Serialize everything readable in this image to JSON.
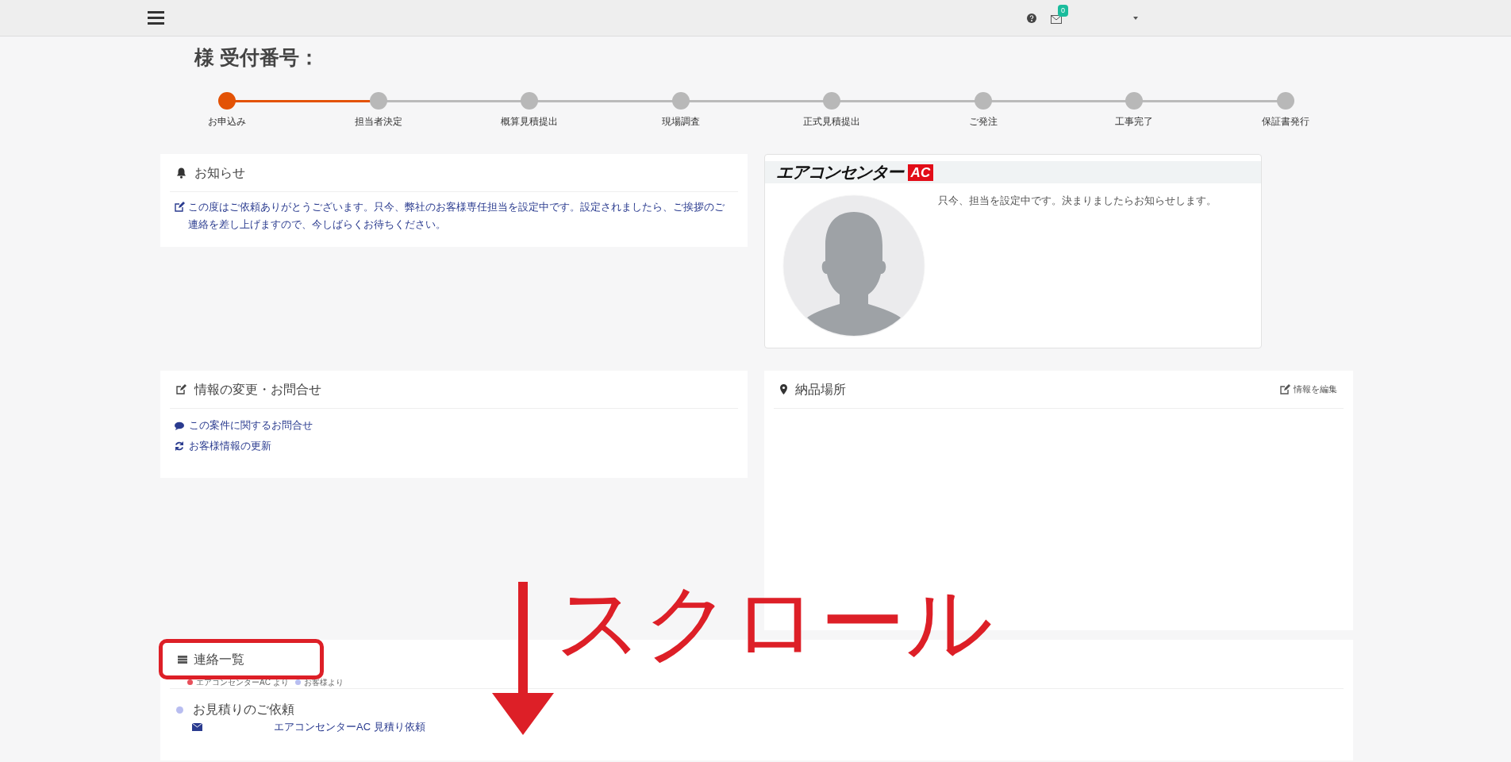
{
  "header": {
    "notification_count": "0"
  },
  "page_title": "様 受付番号：",
  "steps": [
    {
      "label": "お申込み",
      "active": true
    },
    {
      "label": "担当者決定",
      "active": false
    },
    {
      "label": "概算見積提出",
      "active": false
    },
    {
      "label": "現場調査",
      "active": false
    },
    {
      "label": "正式見積提出",
      "active": false
    },
    {
      "label": "ご発注",
      "active": false
    },
    {
      "label": "工事完了",
      "active": false
    },
    {
      "label": "保証書発行",
      "active": false
    }
  ],
  "notice": {
    "title": "お知らせ",
    "message": "この度はご依頼ありがとうございます。只今、弊社のお客様専任担当を設定中です。設定されましたら、ご挨拶のご連絡を差し上げますので、今しばらくお待ちください。"
  },
  "staff_card": {
    "logo_text": "エアコンセンター",
    "logo_badge": "AC",
    "message": "只今、担当を設定中です。決まりましたらお知らせします。"
  },
  "inquiry": {
    "title": "情報の変更・お問合せ",
    "links": [
      {
        "kind": "chat",
        "label": "この案件に関するお問合せ"
      },
      {
        "kind": "refresh",
        "label": "お客様情報の更新"
      }
    ]
  },
  "delivery": {
    "title": "納品場所",
    "edit_link": "情報を編集"
  },
  "messages": {
    "title": "連絡一覧",
    "legend": [
      {
        "label": "エアコンセンターAC より",
        "color": "#e8505b"
      },
      {
        "label": "お客様より",
        "color": "#b8bdf0"
      }
    ],
    "items": [
      {
        "title": "お見積りのご依頼",
        "subject": "エアコンセンターAC 見積り依頼"
      }
    ]
  },
  "annotation": {
    "label": "スクロール"
  }
}
